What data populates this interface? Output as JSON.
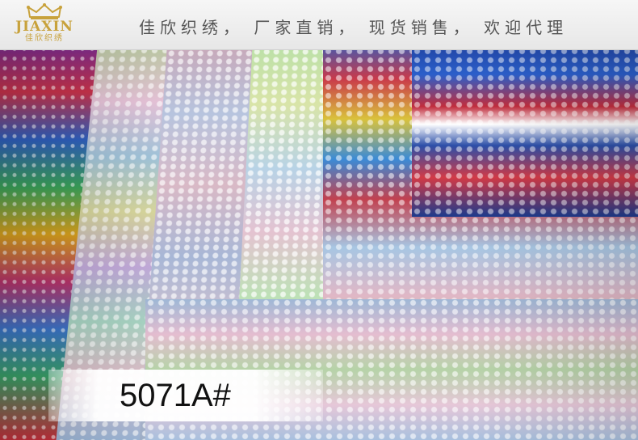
{
  "brand": {
    "name": "JIAXIN",
    "name_cn": "佳欣织绣",
    "logo_icon": "crown-icon",
    "color": "#c8a23c"
  },
  "banner": {
    "slogan": "佳欣织绣， 厂家直销， 现货销售， 欢迎代理"
  },
  "product": {
    "code": "5071A#"
  }
}
